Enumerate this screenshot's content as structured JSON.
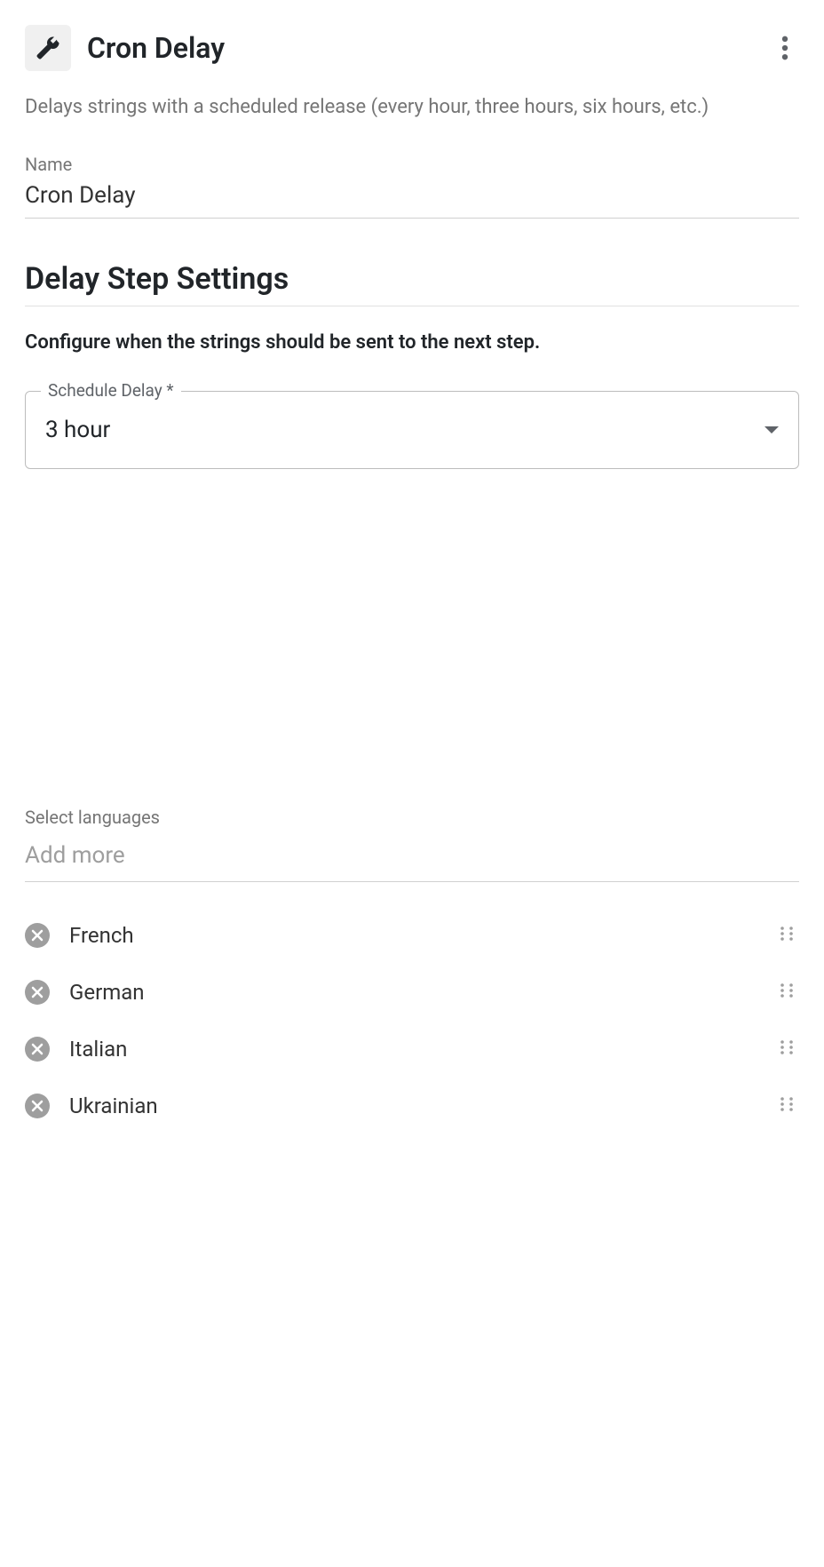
{
  "header": {
    "title": "Cron Delay"
  },
  "description": "Delays strings with a scheduled release (every hour, three hours, six hours, etc.)",
  "nameField": {
    "label": "Name",
    "value": "Cron Delay"
  },
  "settings": {
    "heading": "Delay Step Settings",
    "subheading": "Configure when the strings should be sent to the next step.",
    "scheduleLabel": "Schedule Delay *",
    "scheduleValue": "3 hour"
  },
  "languages": {
    "label": "Select languages",
    "placeholder": "Add more",
    "items": [
      {
        "name": "French"
      },
      {
        "name": "German"
      },
      {
        "name": "Italian"
      },
      {
        "name": "Ukrainian"
      }
    ]
  }
}
